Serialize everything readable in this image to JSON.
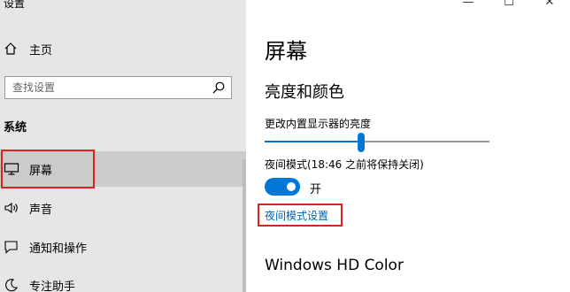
{
  "app": {
    "title": "设置"
  },
  "window_controls": {
    "minimize": "—",
    "maximize": "☐"
  },
  "sidebar": {
    "home_label": "主页",
    "search_placeholder": "查找设置",
    "section_title": "系统",
    "items": [
      {
        "label": "屏幕",
        "icon": "monitor-icon",
        "selected": true
      },
      {
        "label": "声音",
        "icon": "speaker-icon",
        "selected": false
      },
      {
        "label": "通知和操作",
        "icon": "notification-icon",
        "selected": false
      },
      {
        "label": "专注助手",
        "icon": "moon-icon",
        "selected": false
      }
    ]
  },
  "main": {
    "page_title": "屏幕",
    "brightness_section": "亮度和颜色",
    "brightness_label": "更改内置显示器的亮度",
    "brightness_value": 0.43,
    "night_light_label": "夜间模式(18:46 之前将保持关闭)",
    "night_light_state": "开",
    "night_light_on": true,
    "night_light_settings_link": "夜间模式设置",
    "hd_color_title": "Windows HD Color"
  },
  "colors": {
    "accent": "#0078d7",
    "link": "#0063b1",
    "highlight_box": "#e0201e",
    "sidebar_bg": "#e6e6e6"
  }
}
